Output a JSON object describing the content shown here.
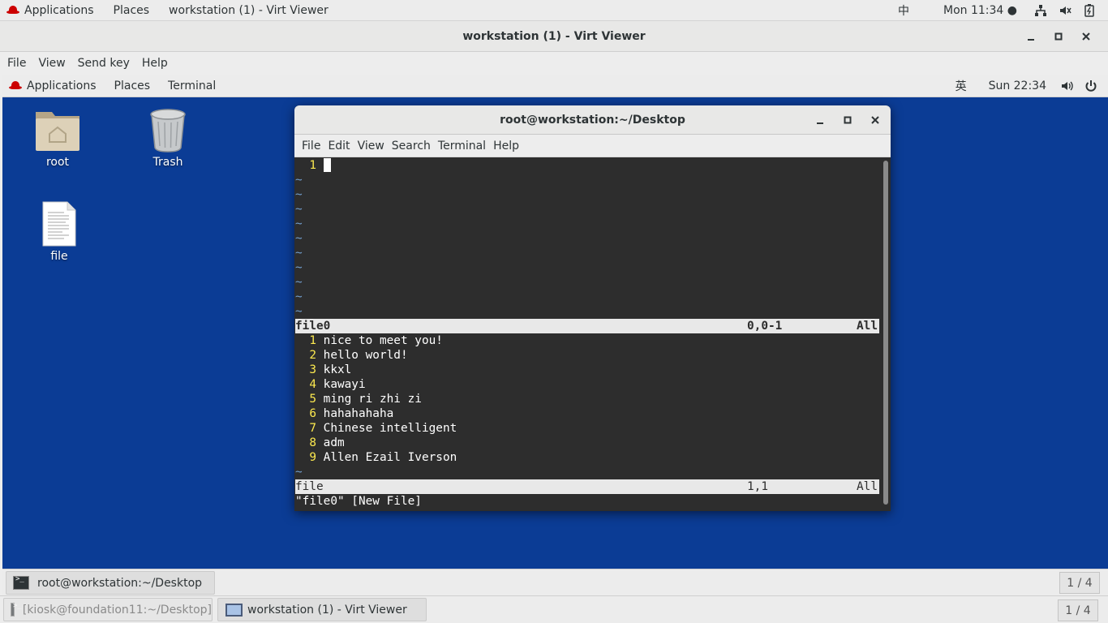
{
  "host_topbar": {
    "applications": "Applications",
    "places": "Places",
    "window_title": "workstation (1) - Virt Viewer",
    "input_method": "中",
    "clock": "Mon 11:34 ●"
  },
  "viewer": {
    "title": "workstation (1) - Virt Viewer",
    "menu": {
      "file": "File",
      "view": "View",
      "send_key": "Send key",
      "help": "Help"
    }
  },
  "guest_topbar": {
    "applications": "Applications",
    "places": "Places",
    "terminal": "Terminal",
    "input_method": "英",
    "clock": "Sun 22:34"
  },
  "desktop_icons": [
    {
      "label": "root"
    },
    {
      "label": "Trash"
    },
    {
      "label": "file"
    }
  ],
  "terminal": {
    "title": "root@workstation:~/Desktop",
    "menu": {
      "file": "File",
      "edit": "Edit",
      "view": "View",
      "search": "Search",
      "terminal": "Terminal",
      "help": "Help"
    },
    "top_pane": {
      "line_number": "  1 ",
      "tilde": "~",
      "status_name": "file0",
      "status_pos": "0,0-1",
      "status_all": "All"
    },
    "bottom_pane": {
      "lines": [
        {
          "num": "  1 ",
          "text": "nice to meet you!"
        },
        {
          "num": "  2 ",
          "text": "hello world!"
        },
        {
          "num": "  3 ",
          "text": "kkxl"
        },
        {
          "num": "  4 ",
          "text": "kawayi"
        },
        {
          "num": "  5 ",
          "text": "ming ri zhi zi"
        },
        {
          "num": "  6 ",
          "text": "hahahahaha"
        },
        {
          "num": "  7 ",
          "text": "Chinese intelligent"
        },
        {
          "num": "  8 ",
          "text": "adm"
        },
        {
          "num": "  9 ",
          "text": "Allen Ezail Iverson"
        }
      ],
      "tilde": "~",
      "status_name": "file",
      "status_pos": "1,1",
      "status_all": "All"
    },
    "message": "\"file0\" [New File]"
  },
  "guest_taskbar": {
    "task": "root@workstation:~/Desktop",
    "workspace": "1 / 4"
  },
  "host_taskbar": {
    "task_inactive": "[kiosk@foundation11:~/Desktop]",
    "task_active": "workstation (1) - Virt Viewer",
    "workspace": "1 / 4"
  }
}
